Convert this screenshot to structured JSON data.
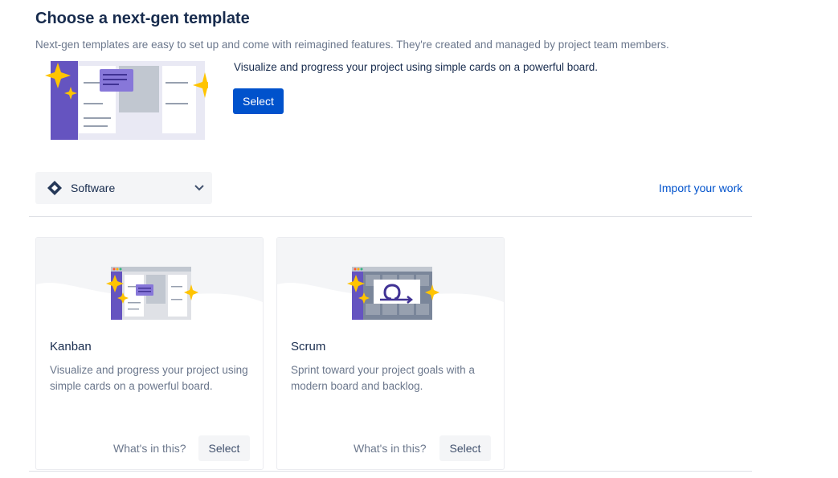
{
  "header": {
    "title": "Choose a next-gen template",
    "subtitle": "Next-gen templates are easy to set up and come with reimagined features. They're created and managed by project team members."
  },
  "featured": {
    "description": "Visualize and progress your project using simple cards on a powerful board.",
    "select_label": "Select"
  },
  "category": {
    "selected": "Software",
    "icon": "jira-software-diamond-icon"
  },
  "import_link": "Import your work",
  "templates": [
    {
      "title": "Kanban",
      "description": "Visualize and progress your project using simple cards on a powerful board.",
      "whats_in_label": "What's in this?",
      "select_label": "Select"
    },
    {
      "title": "Scrum",
      "description": "Sprint toward your project goals with a modern board and backlog.",
      "whats_in_label": "What's in this?",
      "select_label": "Select"
    }
  ],
  "colors": {
    "primary": "#0052cc",
    "heading": "#172b4d",
    "muted": "#6b778c",
    "illustration_purple": "#6554c0",
    "star_yellow": "#ffc400"
  }
}
